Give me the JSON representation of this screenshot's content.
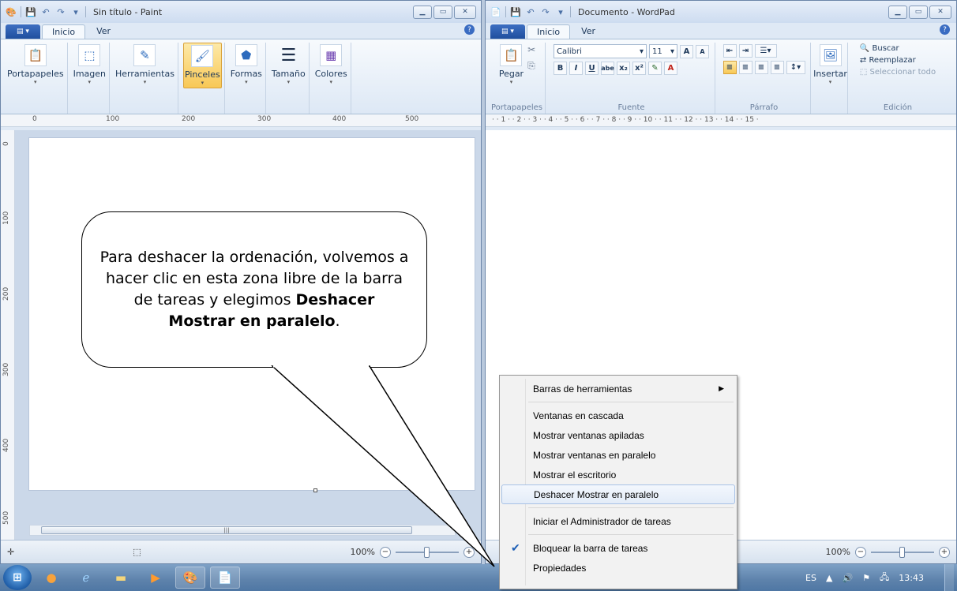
{
  "paint": {
    "title": "Sin título - Paint",
    "tabs": [
      "Inicio",
      "Ver"
    ],
    "ribbon": [
      "Portapapeles",
      "Imagen",
      "Herramientas",
      "Pinceles",
      "Formas",
      "Tamaño",
      "Colores"
    ],
    "ruler": [
      "0",
      "100",
      "200",
      "300",
      "400",
      "500"
    ],
    "vruler": [
      "0",
      "100",
      "200",
      "300",
      "400",
      "500"
    ],
    "zoom": "100%"
  },
  "wordpad": {
    "title": "Documento - WordPad",
    "tabs": [
      "Inicio",
      "Ver"
    ],
    "paste_label": "Pegar",
    "font_name": "Calibri",
    "font_size": "11",
    "groups": [
      "Portapapeles",
      "Fuente",
      "Párrafo",
      "Edición"
    ],
    "insert_label": "Insertar",
    "edit": {
      "find": "Buscar",
      "replace": "Reemplazar",
      "select_all": "Seleccionar todo"
    },
    "ruler": "· · 1 · · 2 · · 3 · · 4 · · 5 · · 6 · · 7 · · 8 · · 9 · · 10 · · 11 · · 12 · · 13 · · 14 · · 15 ·",
    "zoom": "100%"
  },
  "callout": {
    "text_plain": "Para deshacer la ordenación, volvemos a hacer clic en esta zona libre de la barra de tareas y elegimos ",
    "text_bold": "Deshacer Mostrar en paralelo",
    "text_end": "."
  },
  "context_menu": {
    "toolbars": "Barras de herramientas",
    "cascade": "Ventanas en cascada",
    "stacked": "Mostrar ventanas apiladas",
    "side_by_side": "Mostrar ventanas en paralelo",
    "desktop": "Mostrar el escritorio",
    "undo": "Deshacer Mostrar en paralelo",
    "task_manager": "Iniciar el Administrador de tareas",
    "lock": "Bloquear la barra de tareas",
    "properties": "Propiedades"
  },
  "taskbar": {
    "language": "ES",
    "clock": "13:43"
  }
}
